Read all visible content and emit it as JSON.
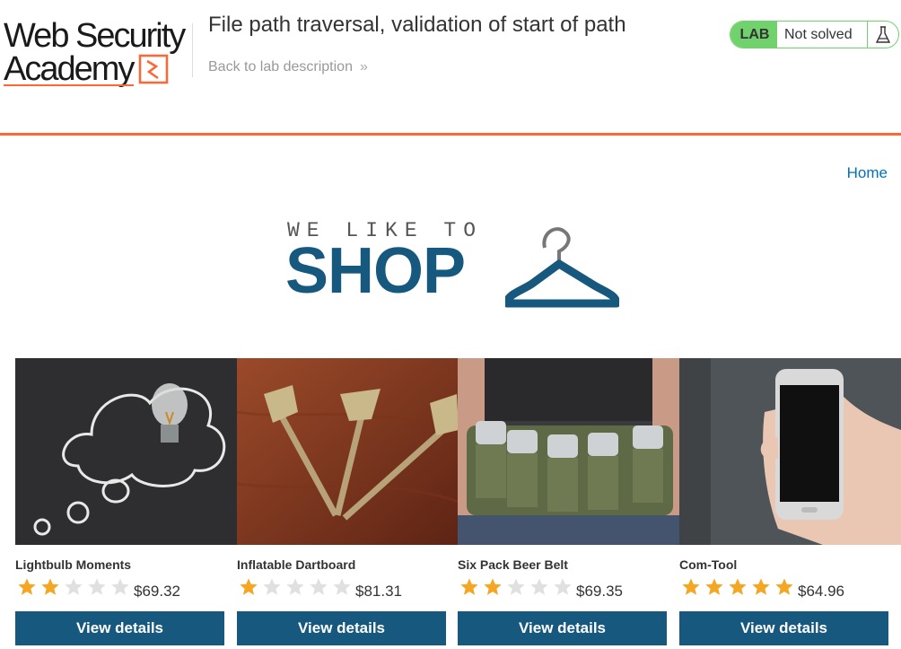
{
  "header": {
    "logo_line1": "Web Security",
    "logo_line2": "Academy",
    "lab_title": "File path traversal, validation of start of path",
    "back_link": "Back to lab description",
    "back_chevron": "»",
    "status_label": "LAB",
    "status_text": "Not solved",
    "status_icon": "flask-icon"
  },
  "nav": {
    "home": "Home"
  },
  "banner": {
    "tagline": "WE LIKE TO",
    "word": "SHOP",
    "icon": "coat-hanger-icon"
  },
  "colors": {
    "accent": "#ff6633",
    "primary": "#17587e",
    "status_green": "#70d16d",
    "link": "#0071bc",
    "star_on": "#f5a623",
    "star_off": "#e0e0e0"
  },
  "button_label": "View details",
  "products": [
    {
      "name": "Lightbulb Moments",
      "rating": 2,
      "rating_max": 5,
      "price": "$69.32",
      "image": "lightbulb-chalkboard-image"
    },
    {
      "name": "Inflatable Dartboard",
      "rating": 1,
      "rating_max": 5,
      "price": "$81.31",
      "image": "darts-image"
    },
    {
      "name": "Six Pack Beer Belt",
      "rating": 2,
      "rating_max": 5,
      "price": "$69.35",
      "image": "beer-belt-image"
    },
    {
      "name": "Com-Tool",
      "rating": 5,
      "rating_max": 5,
      "price": "$64.96",
      "image": "smartphone-hand-image"
    }
  ]
}
